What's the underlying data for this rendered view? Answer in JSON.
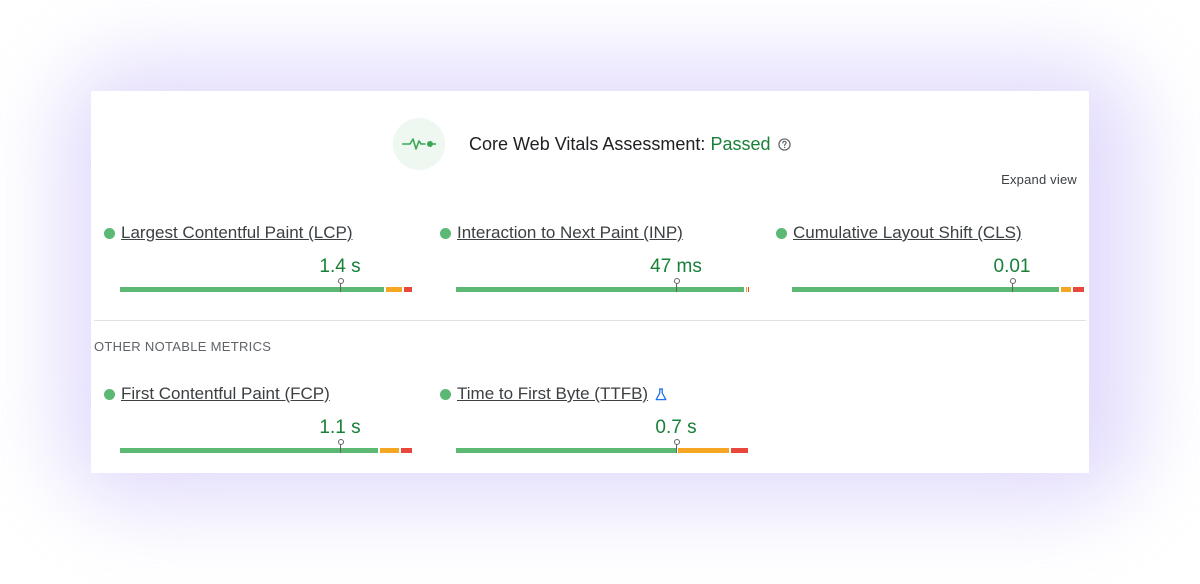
{
  "header": {
    "title": "Core Web Vitals Assessment:",
    "status": "Passed",
    "colors": {
      "status": "#188038",
      "icon_bg": "#eef8f0",
      "accent": "#5bb974"
    }
  },
  "expand_label": "Expand view",
  "core_metrics": [
    {
      "label": "Largest Contentful Paint (LCP)",
      "value": "1.4 s",
      "distribution": {
        "good": 0.905,
        "needs_improvement": 0.06,
        "poor": 0.035
      },
      "marker": 0.75
    },
    {
      "label": "Interaction to Next Paint (INP)",
      "value": "47 ms",
      "distribution": {
        "good": 0.985,
        "needs_improvement": 0.008,
        "poor": 0.007
      },
      "marker": 0.75
    },
    {
      "label": "Cumulative Layout Shift (CLS)",
      "value": "0.01",
      "distribution": {
        "good": 0.915,
        "needs_improvement": 0.04,
        "poor": 0.045
      },
      "marker": 0.75
    }
  ],
  "other_section_label": "OTHER NOTABLE METRICS",
  "other_metrics": [
    {
      "label": "First Contentful Paint (FCP)",
      "value": "1.1 s",
      "distribution": {
        "good": 0.885,
        "needs_improvement": 0.07,
        "poor": 0.045
      },
      "marker": 0.75
    },
    {
      "label": "Time to First Byte (TTFB)",
      "value": "0.7 s",
      "icon": "experimental-flask-icon",
      "distribution": {
        "good": 0.755,
        "needs_improvement": 0.18,
        "poor": 0.065
      },
      "marker": 0.75
    }
  ]
}
